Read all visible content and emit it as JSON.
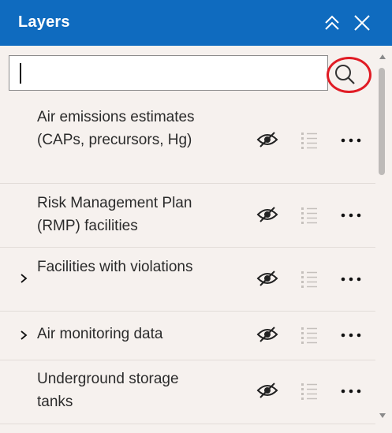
{
  "header": {
    "title": "Layers"
  },
  "search": {
    "value": "",
    "placeholder": ""
  },
  "icons": {
    "collapse": "double-chevron-up-icon",
    "close": "close-icon",
    "search": "search-icon",
    "expand": "chevron-right-icon",
    "visibility": "eye-off-icon",
    "legend": "legend-list-icon",
    "more": "more-options-icon"
  },
  "colors": {
    "header": "#0f6bbf",
    "panel": "#f6f1ee",
    "highlight": "#e01b24"
  },
  "layers": [
    {
      "label": "Air emissions estimates (CAPs, precursors, Hg)",
      "expandable": false,
      "visible": false
    },
    {
      "label": "Risk Management Plan (RMP) facilities",
      "expandable": false,
      "visible": false
    },
    {
      "label": "Facilities with violations",
      "expandable": true,
      "visible": false
    },
    {
      "label": "Air monitoring data",
      "expandable": true,
      "visible": false
    },
    {
      "label": "Underground storage tanks",
      "expandable": false,
      "visible": false
    }
  ]
}
